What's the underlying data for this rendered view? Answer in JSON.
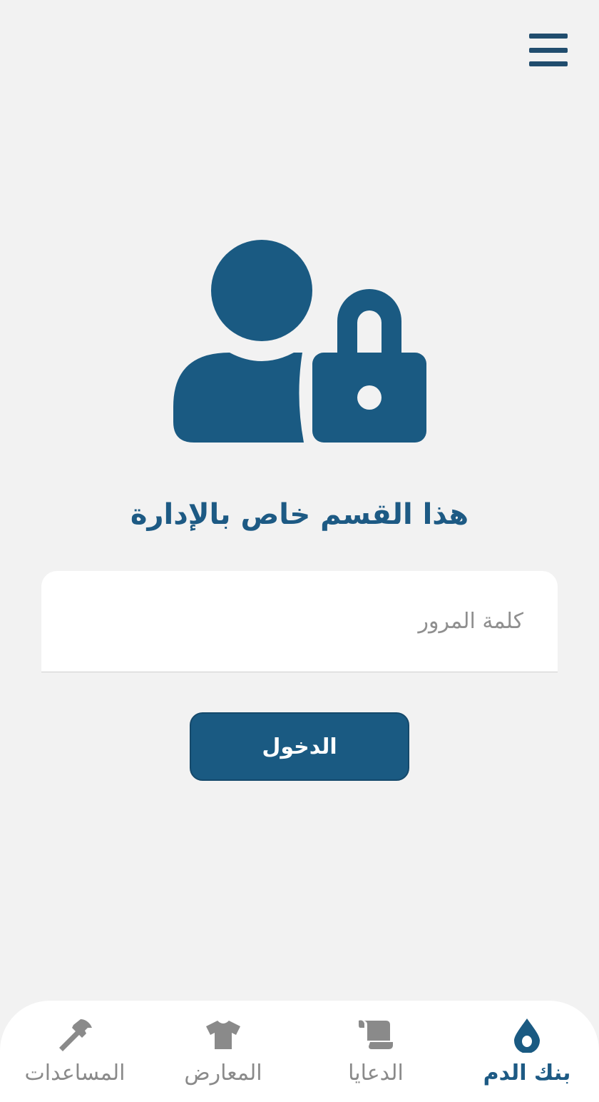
{
  "colors": {
    "primary": "#1a5a82",
    "menu_icon": "#214d6e",
    "background": "#f2f2f2",
    "nav_inactive": "#8a8a8a"
  },
  "header": {
    "menu_icon": "hamburger-menu-icon"
  },
  "hero": {
    "icon": "user-lock-icon"
  },
  "login": {
    "heading": "هذا القسم خاص بالإدارة",
    "password_placeholder": "كلمة المرور",
    "password_value": "",
    "submit_label": "الدخول"
  },
  "bottom_nav": {
    "items": [
      {
        "label": "بنك الدم",
        "icon": "blood-drop-icon",
        "active": true
      },
      {
        "label": "الدعايا",
        "icon": "scroll-icon",
        "active": false
      },
      {
        "label": "المعارض",
        "icon": "tshirt-icon",
        "active": false
      },
      {
        "label": "المساعدات",
        "icon": "hammer-icon",
        "active": false
      }
    ]
  }
}
